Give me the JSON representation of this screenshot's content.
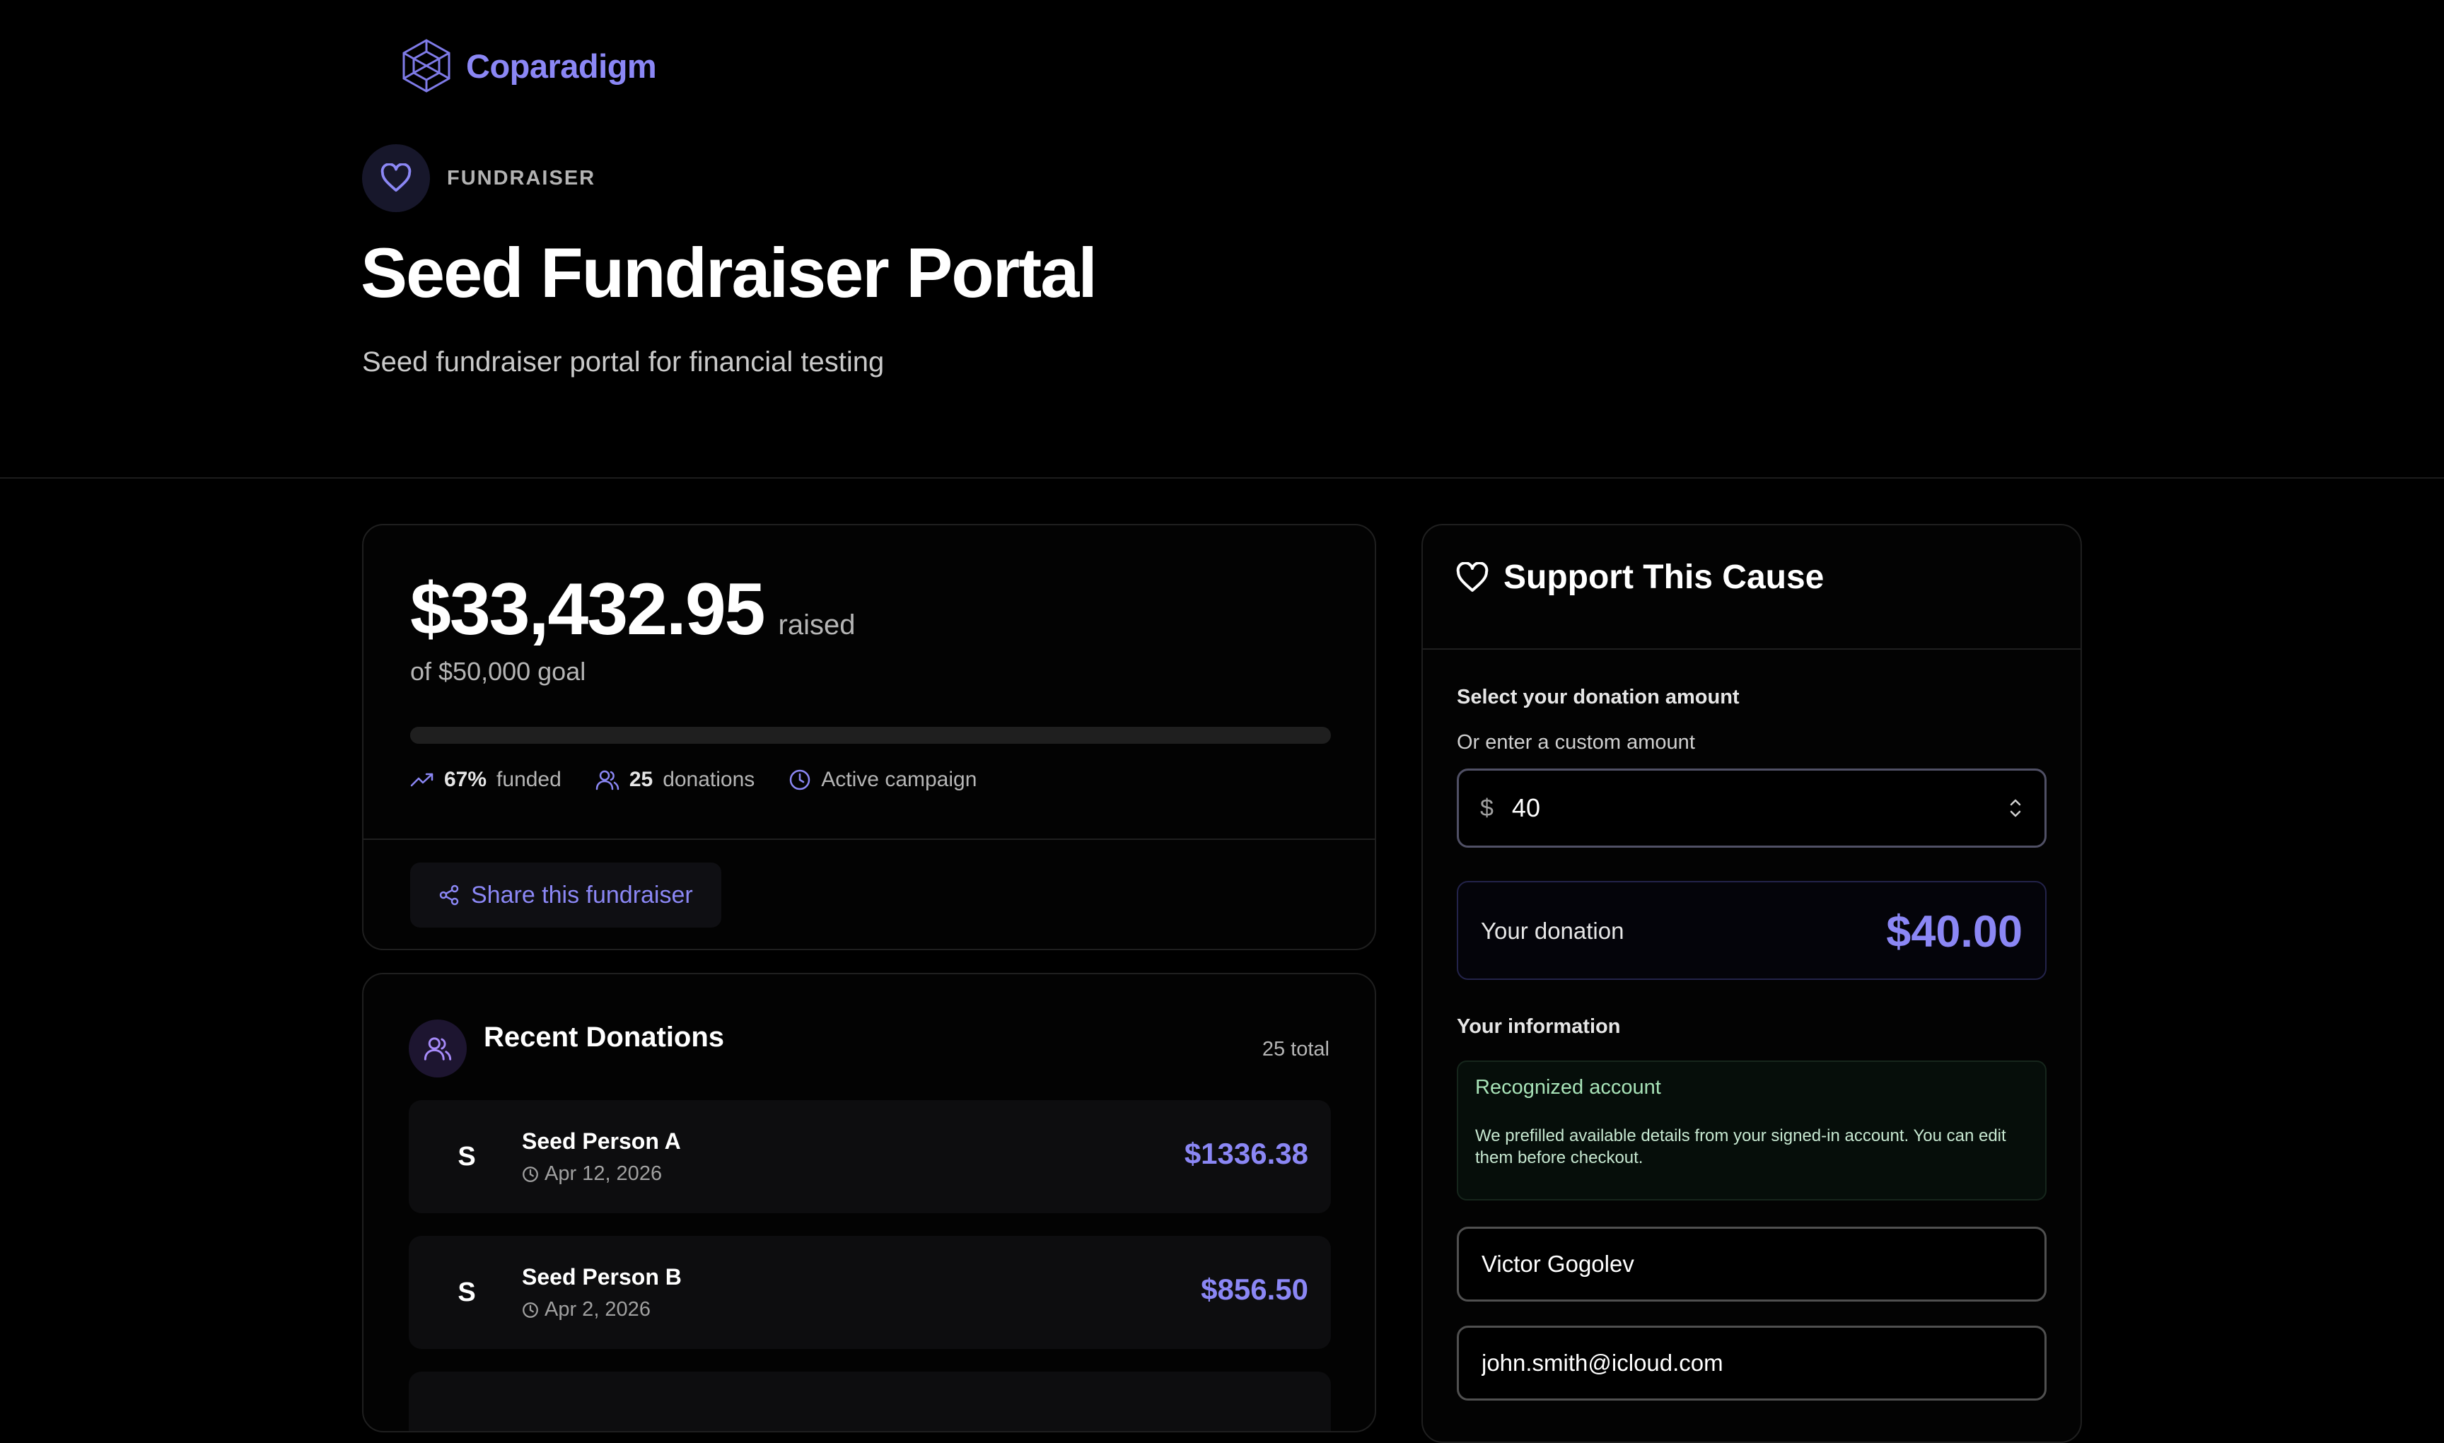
{
  "brand": {
    "name": "Coparadigm"
  },
  "header": {
    "tag": "FUNDRAISER",
    "title": "Seed Fundraiser Portal",
    "subtitle": "Seed fundraiser portal for financial testing"
  },
  "summary": {
    "raised_amount": "$33,432.95",
    "raised_word": "raised",
    "goal_text": "of $50,000 goal",
    "progress_fraction": 0.67,
    "funded_percent": "67%",
    "funded_label": "funded",
    "donations_count": "25",
    "donations_label": "donations",
    "status": "Active campaign",
    "share_label": "Share this fundraiser"
  },
  "recent_donations": {
    "title": "Recent Donations",
    "total": "25 total",
    "items": [
      {
        "initial": "S",
        "name": "Seed Person A",
        "date": "Apr 12, 2026",
        "amount": "$1336.38"
      },
      {
        "initial": "S",
        "name": "Seed Person B",
        "date": "Apr 2, 2026",
        "amount": "$856.50"
      }
    ]
  },
  "support": {
    "title": "Support This Cause",
    "select_label": "Select your donation amount",
    "custom_label": "Or enter a custom amount",
    "currency_symbol": "$",
    "custom_amount": "40",
    "your_donation_label": "Your donation",
    "your_donation_value": "$40.00",
    "info_label": "Your information",
    "recognized_title": "Recognized account",
    "recognized_desc": "We prefilled available details from your signed-in account. You can edit them before checkout.",
    "name_value": "Victor Gogolev",
    "email_value": "john.smith@icloud.com"
  },
  "colors": {
    "accent": "#8b87f5",
    "background": "#000000",
    "card_border": "#1f1f1f",
    "recognized_text": "#a8e3b8"
  }
}
